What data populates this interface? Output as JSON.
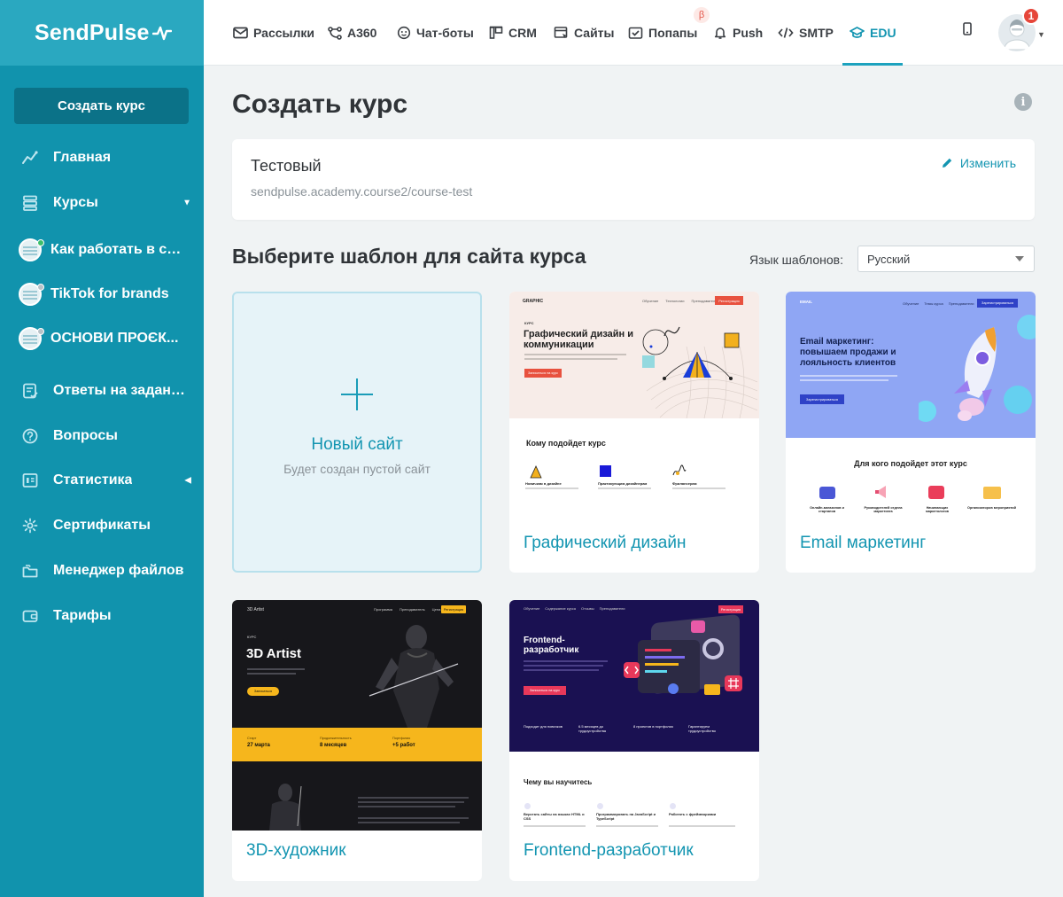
{
  "brand": {
    "logo_text": "SendPulse"
  },
  "sidebar": {
    "create_button": "Создать курс",
    "items": [
      {
        "label": "Главная",
        "icon": "chart-line-icon"
      },
      {
        "label": "Курсы",
        "icon": "courses-icon"
      },
      {
        "label": "Как работать в се...",
        "icon": "course-avatar",
        "status_color": "#3bbf6b"
      },
      {
        "label": "TikTok for brands",
        "icon": "course-avatar",
        "status_color": "#b7c2c8"
      },
      {
        "label": "ОСНОВИ ПРОЄК...",
        "icon": "course-avatar",
        "status_color": "#b7c2c8"
      },
      {
        "label": "Ответы на задания",
        "icon": "answers-icon"
      },
      {
        "label": "Вопросы",
        "icon": "question-icon"
      },
      {
        "label": "Статистика",
        "icon": "stats-icon"
      },
      {
        "label": "Сертификаты",
        "icon": "gear-icon"
      },
      {
        "label": "Менеджер файлов",
        "icon": "folder-icon"
      },
      {
        "label": "Тарифы",
        "icon": "wallet-icon"
      }
    ]
  },
  "topnav": {
    "items": [
      {
        "label": "Рассылки",
        "icon": "mail-icon"
      },
      {
        "label": "А360",
        "icon": "flow-icon"
      },
      {
        "label": "Чат-боты",
        "icon": "chat-icon"
      },
      {
        "label": "CRM",
        "icon": "crm-icon"
      },
      {
        "label": "Сайты",
        "icon": "site-icon"
      },
      {
        "label": "Попапы",
        "icon": "popup-icon"
      },
      {
        "label": "Push",
        "icon": "bell-icon"
      },
      {
        "label": "SMTP",
        "icon": "code-icon"
      },
      {
        "label": "EDU",
        "icon": "graduation-icon"
      }
    ],
    "active": "EDU",
    "beta_label": "β",
    "notifications_count": "1"
  },
  "page": {
    "title": "Создать курс",
    "course": {
      "name": "Тестовый",
      "url": "sendpulse.academy.course2/course-test",
      "edit_label": "Изменить"
    },
    "templates_title": "Выберите шаблон для сайта курса",
    "language_label": "Язык шаблонов:",
    "language_value": "Русский",
    "new_site": {
      "title": "Новый сайт",
      "subtitle": "Будет создан пустой сайт"
    },
    "templates": [
      {
        "name": "Графический дизайн",
        "preview": {
          "brand": "GRAPHIC",
          "nav": [
            "Обучение",
            "Технологии",
            "Преподаватели"
          ],
          "cta": "Регистрация",
          "kicker": "КУРС",
          "headline": "Графический дизайн и коммуникации",
          "button": "Записаться на курс",
          "section": "Кому подойдет курс",
          "audience": [
            "Новичкам в дизайне",
            "Практикующим дизайнерам",
            "Фрилансерам"
          ]
        }
      },
      {
        "name": "Email маркетинг",
        "preview": {
          "brand": "EMAIL",
          "nav": [
            "Обучение",
            "Темы курса",
            "Преподаватели"
          ],
          "cta": "Зарегистрироваться",
          "headline": "Email маркетинг: повышаем продажи и лояльность клиентов",
          "button": "Зарегистрироваться",
          "section": "Для кого подойдет этот курс",
          "audience": [
            "Онлайн-магазинов и стартапов",
            "Руководителей отдела маркетинга",
            "Начинающих маркетологов",
            "Организаторов мероприятий"
          ]
        }
      },
      {
        "name": "3D-художник",
        "preview": {
          "brand": "3D Artist",
          "nav": [
            "Программа",
            "Преподаватель",
            "Цена"
          ],
          "cta": "Регистрация",
          "kicker": "КУРС",
          "headline": "3D Artist",
          "button": "Записаться",
          "facts": [
            {
              "label": "Старт",
              "value": "27 марта"
            },
            {
              "label": "Продолжительность",
              "value": "8 месяцев"
            },
            {
              "label": "Портфолио",
              "value": "+5 работ"
            }
          ]
        }
      },
      {
        "name": "Frontend-разработчик",
        "preview": {
          "nav": [
            "Обучение",
            "Содержание курса",
            "Отзывы",
            "Преподаватели"
          ],
          "cta": "Регистрация",
          "headline": "Frontend-разработчик",
          "button": "Записаться на курс",
          "facts": [
            "Подходит для новичков",
            "6.5 месяцев до трудоустройства",
            "8 проектов в портфолио",
            "Гарантируем трудоустройство"
          ],
          "section": "Чему вы научитесь",
          "skills": [
            "Верстать сайты на языках HTML и CSS",
            "Программировать на JavaScript и TypeScript",
            "Работать с фреймворками"
          ]
        }
      }
    ]
  },
  "colors": {
    "sidebar": "#1193ad",
    "logo_bg": "#2aa8c0",
    "accent": "#1395b1",
    "badge": "#e6463a"
  }
}
